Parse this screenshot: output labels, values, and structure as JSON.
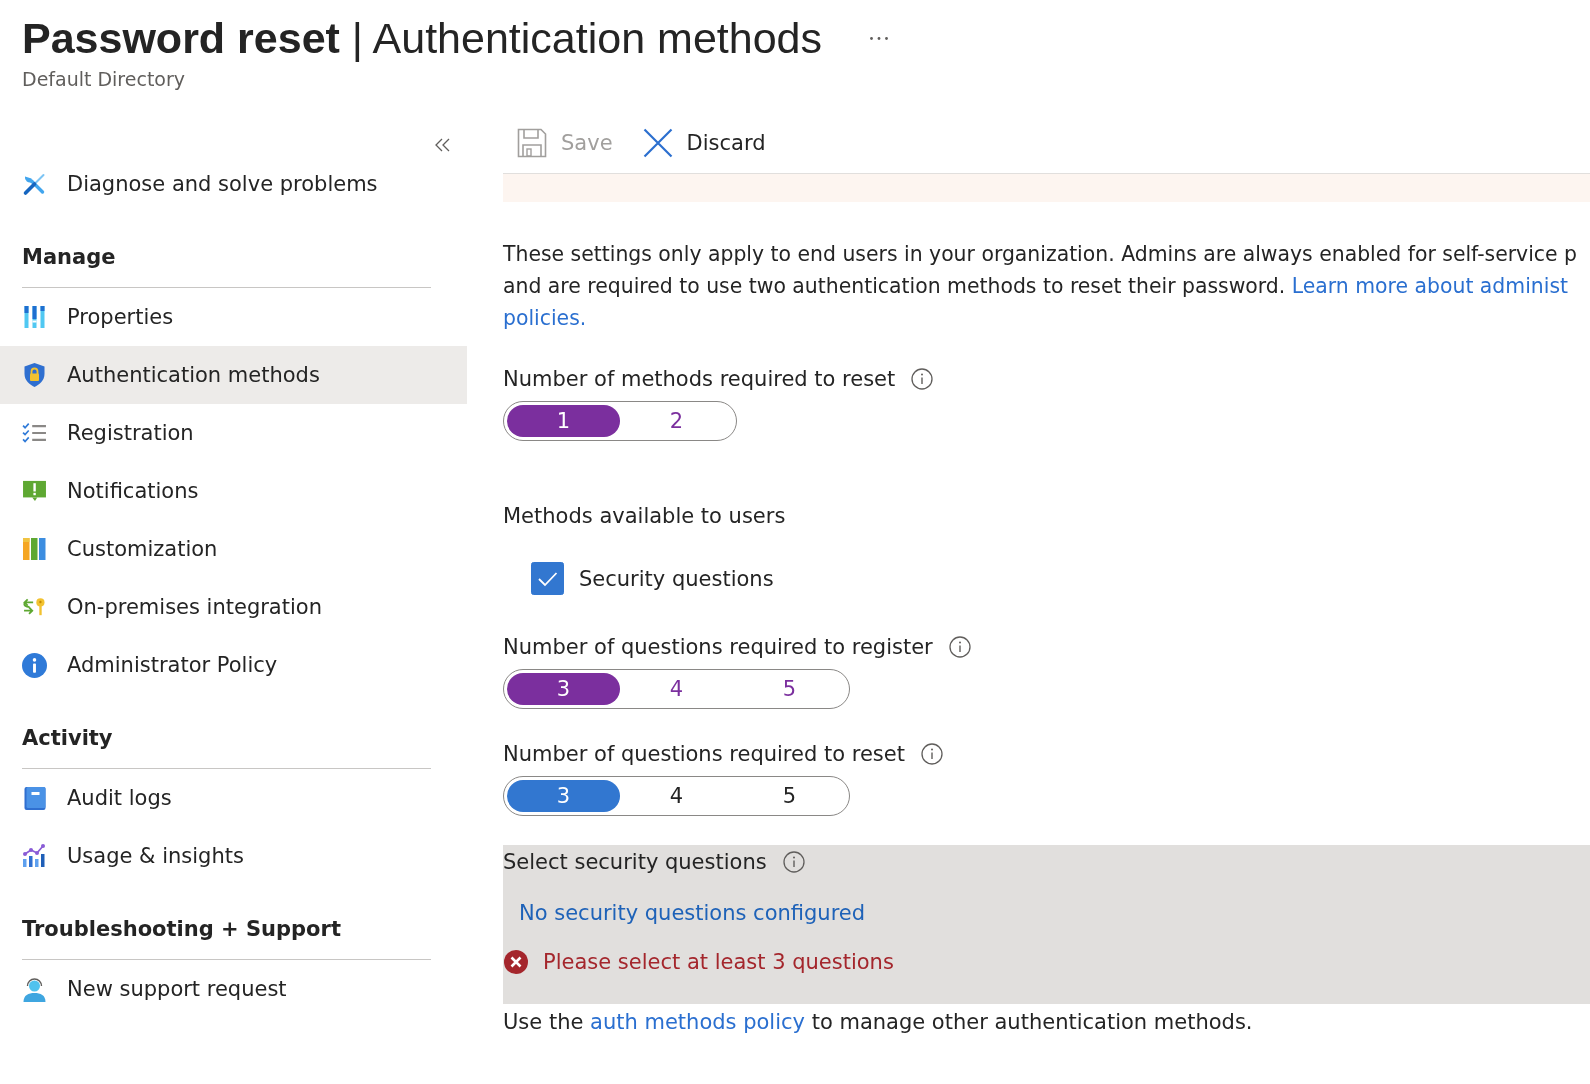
{
  "header": {
    "title": "**Password reset** | Authentication methods",
    "subtitle": "Default Directory"
  },
  "sidebar": {
    "items": [
      {
        "label": "Diagnose and solve problems",
        "selected": false
      }
    ],
    "sections": [
      {
        "heading": "Manage",
        "items": [
          {
            "label": "Properties",
            "selected": false
          },
          {
            "label": "Authentication methods",
            "selected": true
          },
          {
            "label": "Registration",
            "selected": false
          },
          {
            "label": "Notifications",
            "selected": false
          },
          {
            "label": "Customization",
            "selected": false
          },
          {
            "label": "On-premises integration",
            "selected": false
          },
          {
            "label": "Administrator Policy",
            "selected": false
          }
        ]
      },
      {
        "heading": "Activity",
        "items": [
          {
            "label": "Audit logs",
            "selected": false
          },
          {
            "label": "Usage & insights",
            "selected": false
          }
        ]
      },
      {
        "heading": "Troubleshooting + Support",
        "items": [
          {
            "label": "New support request",
            "selected": false
          }
        ]
      }
    ]
  },
  "toolbar": {
    "buttons": [
      {
        "label": "Save",
        "disabled": true
      },
      {
        "label": "Discard",
        "disabled": false
      }
    ]
  },
  "description": {
    "lines": [
      "These settings only apply to end users in your organization. Admins are always enabled for self-service p",
      "and are required to use two authentication methods to reset their password."
    ],
    "link_lines": [
      "Learn more about administ",
      "policies."
    ]
  },
  "settings": [
    {
      "kind": "options",
      "label": "Number of methods required to reset",
      "info": true,
      "modified": true,
      "options": [
        {
          "label": "1",
          "selected": true
        },
        {
          "label": "2",
          "selected": false
        }
      ]
    },
    {
      "kind": "checklist",
      "label": "Methods available to users",
      "info": false,
      "modified": false,
      "items": [
        {
          "label": "Security questions",
          "checked": true
        }
      ]
    },
    {
      "kind": "options",
      "label": "Number of questions required to register",
      "info": true,
      "modified": true,
      "options": [
        {
          "label": "3",
          "selected": true
        },
        {
          "label": "4",
          "selected": false
        },
        {
          "label": "5",
          "selected": false
        }
      ]
    },
    {
      "kind": "options",
      "label": "Number of questions required to reset",
      "info": true,
      "modified": false,
      "options": [
        {
          "label": "3",
          "selected": true
        },
        {
          "label": "4",
          "selected": false
        },
        {
          "label": "5",
          "selected": false
        }
      ]
    }
  ],
  "security_questions": {
    "label": "Select security questions",
    "info": true,
    "link": "No security questions configured",
    "error": "Please select at least 3 questions"
  },
  "footer": {
    "prefix": "Use the",
    "link": "auth methods policy",
    "suffix": "to manage other authentication methods."
  }
}
